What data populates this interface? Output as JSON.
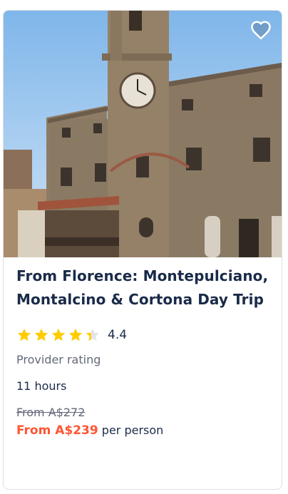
{
  "card": {
    "title": "From Florence: Montepulciano, Montalcino & Cortona Day Trip",
    "rating": {
      "value": 4.4,
      "display": "4.4",
      "stars_total": 5,
      "label": "Provider rating"
    },
    "duration": "11 hours",
    "price": {
      "old": "From A$272",
      "current": "From A$239",
      "suffix": "per person"
    },
    "image_alt": "Historic stone clock tower and palazzo in Cortona",
    "icons": {
      "favorite": "heart-outline-icon",
      "star": "star-icon"
    }
  },
  "colors": {
    "title": "#1a2b49",
    "price": "#ff5533",
    "star": "#ffcc00",
    "muted": "#63687a"
  }
}
